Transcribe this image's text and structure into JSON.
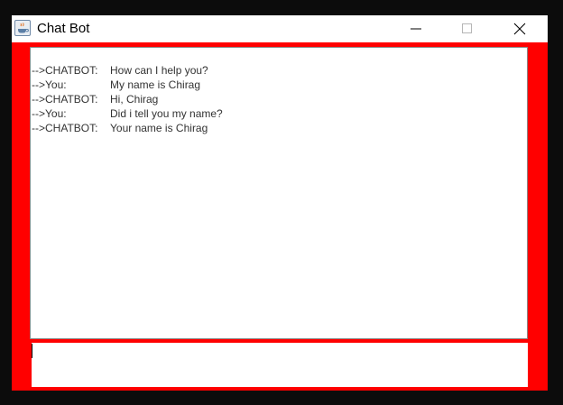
{
  "window": {
    "title": "Chat Bot",
    "app_icon": "java-coffee-cup-icon",
    "controls": [
      "minimize-icon",
      "maximize-icon",
      "close-icon"
    ]
  },
  "colors": {
    "frame_background": "#ff0000",
    "text": "#333333"
  },
  "chat": {
    "lines": [
      {
        "speaker": "-->CHATBOT:",
        "message": "How can I help you?"
      },
      {
        "speaker": "-->You:",
        "message": "My name is Chirag"
      },
      {
        "speaker": "-->CHATBOT:",
        "message": "Hi,  Chirag"
      },
      {
        "speaker": "-->You:",
        "message": "Did i tell you my name?"
      },
      {
        "speaker": "-->CHATBOT:",
        "message": "Your name is  Chirag"
      }
    ]
  },
  "input": {
    "value": ""
  }
}
